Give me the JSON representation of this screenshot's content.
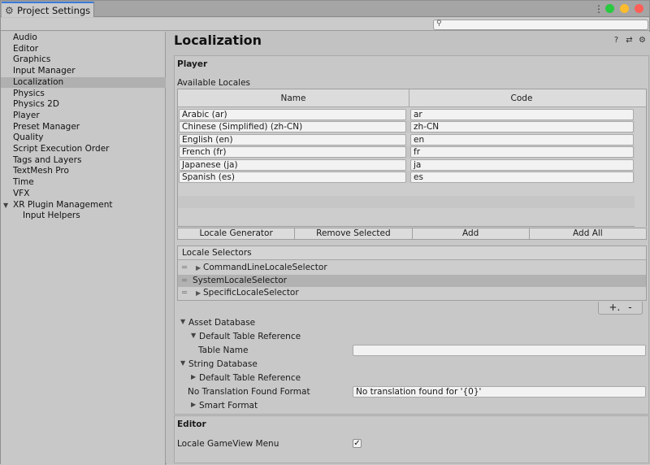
{
  "window": {
    "tab_title": "Project Settings",
    "tab_icon": "gear-icon",
    "traffic_lights": {
      "green": "#29c940",
      "yellow": "#fdbc2e",
      "red": "#fe5f57"
    }
  },
  "search": {
    "placeholder": "",
    "icon": "search-icon"
  },
  "sidebar": {
    "items": [
      {
        "label": "Audio"
      },
      {
        "label": "Editor"
      },
      {
        "label": "Graphics"
      },
      {
        "label": "Input Manager"
      },
      {
        "label": "Localization",
        "selected": true
      },
      {
        "label": "Physics"
      },
      {
        "label": "Physics 2D"
      },
      {
        "label": "Player"
      },
      {
        "label": "Preset Manager"
      },
      {
        "label": "Quality"
      },
      {
        "label": "Script Execution Order"
      },
      {
        "label": "Tags and Layers"
      },
      {
        "label": "TextMesh Pro"
      },
      {
        "label": "Time"
      },
      {
        "label": "VFX"
      },
      {
        "label": "XR Plugin Management",
        "expanded": true
      },
      {
        "label": "Input Helpers",
        "child": true
      }
    ]
  },
  "main": {
    "title": "Localization",
    "header_icons": [
      "help-icon",
      "preset-icon",
      "settings-gear-icon"
    ],
    "player": {
      "title": "Player",
      "available_locales_label": "Available Locales",
      "table": {
        "headers": [
          "Name",
          "Code"
        ],
        "rows": [
          {
            "name": "Arabic (ar)",
            "code": "ar"
          },
          {
            "name": "Chinese (Simplified) (zh-CN)",
            "code": "zh-CN"
          },
          {
            "name": "English (en)",
            "code": "en"
          },
          {
            "name": "French (fr)",
            "code": "fr"
          },
          {
            "name": "Japanese (ja)",
            "code": "ja"
          },
          {
            "name": "Spanish (es)",
            "code": "es"
          }
        ]
      },
      "buttons": [
        "Locale Generator",
        "Remove Selected",
        "Add",
        "Add All"
      ],
      "locale_selectors": {
        "title": "Locale Selectors",
        "items": [
          {
            "label": "CommandLineLocaleSelector",
            "expandable": true
          },
          {
            "label": "SystemLocaleSelector",
            "selected": true
          },
          {
            "label": "SpecificLocaleSelector",
            "expandable": true
          }
        ],
        "add": "+.",
        "remove": "-"
      },
      "asset_database": {
        "title": "Asset Database",
        "default_table_reference": "Default Table Reference",
        "table_name_label": "Table Name",
        "table_name_value": ""
      },
      "string_database": {
        "title": "String Database",
        "default_table_reference": "Default Table Reference",
        "no_translation_label": "No Translation Found Format",
        "no_translation_value": "No translation found for '{0}'",
        "smart_format": "Smart Format"
      }
    },
    "editor": {
      "title": "Editor",
      "locale_gameview_menu_label": "Locale GameView Menu",
      "locale_gameview_menu_checked": true,
      "check_glyph": "✓"
    }
  }
}
